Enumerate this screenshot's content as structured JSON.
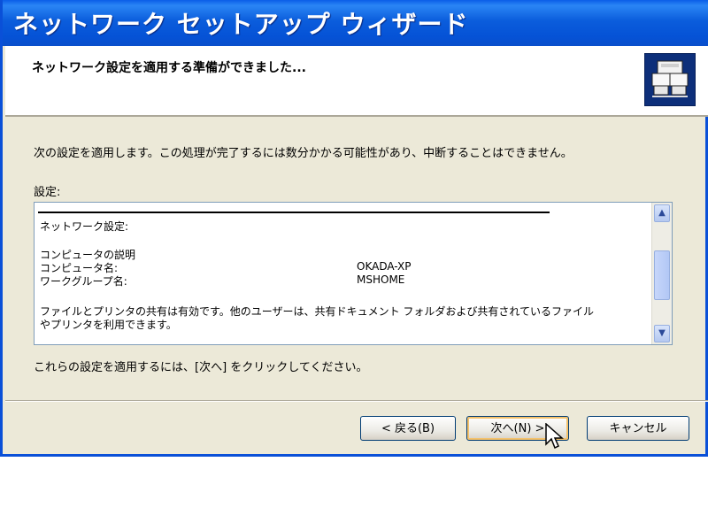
{
  "window": {
    "title": "ネットワーク セットアップ ウィザード"
  },
  "header": {
    "heading": "ネットワーク設定を適用する準備ができました...",
    "icon": "network-wizard-icon"
  },
  "content": {
    "description": "次の設定を適用します。この処理が完了するには数分かかる可能性があり、中断することはできません。",
    "settings_label": "設定:",
    "settings_list": {
      "section_title": "ネットワーク設定:",
      "rows": [
        {
          "label": "コンピュータの説明",
          "value": ""
        },
        {
          "label": "コンピュータ名:",
          "value": "OKADA-XP"
        },
        {
          "label": "ワークグループ名:",
          "value": "MSHOME"
        }
      ],
      "sharing_line1": "ファイルとプリンタの共有は有効です。他のユーザーは、共有ドキュメント フォルダおよび共有されているファイル",
      "sharing_line2": "やプリンタを利用できます。"
    },
    "apply_hint": "これらの設定を適用するには、[次へ] をクリックしてください。"
  },
  "buttons": {
    "back": "< 戻る(B)",
    "next": "次へ(N) >",
    "cancel": "キャンセル"
  },
  "colors": {
    "titlebar": "#0b5ddc",
    "dialog_bg": "#ece9d8",
    "default_button_focus": "#f5c26b"
  }
}
